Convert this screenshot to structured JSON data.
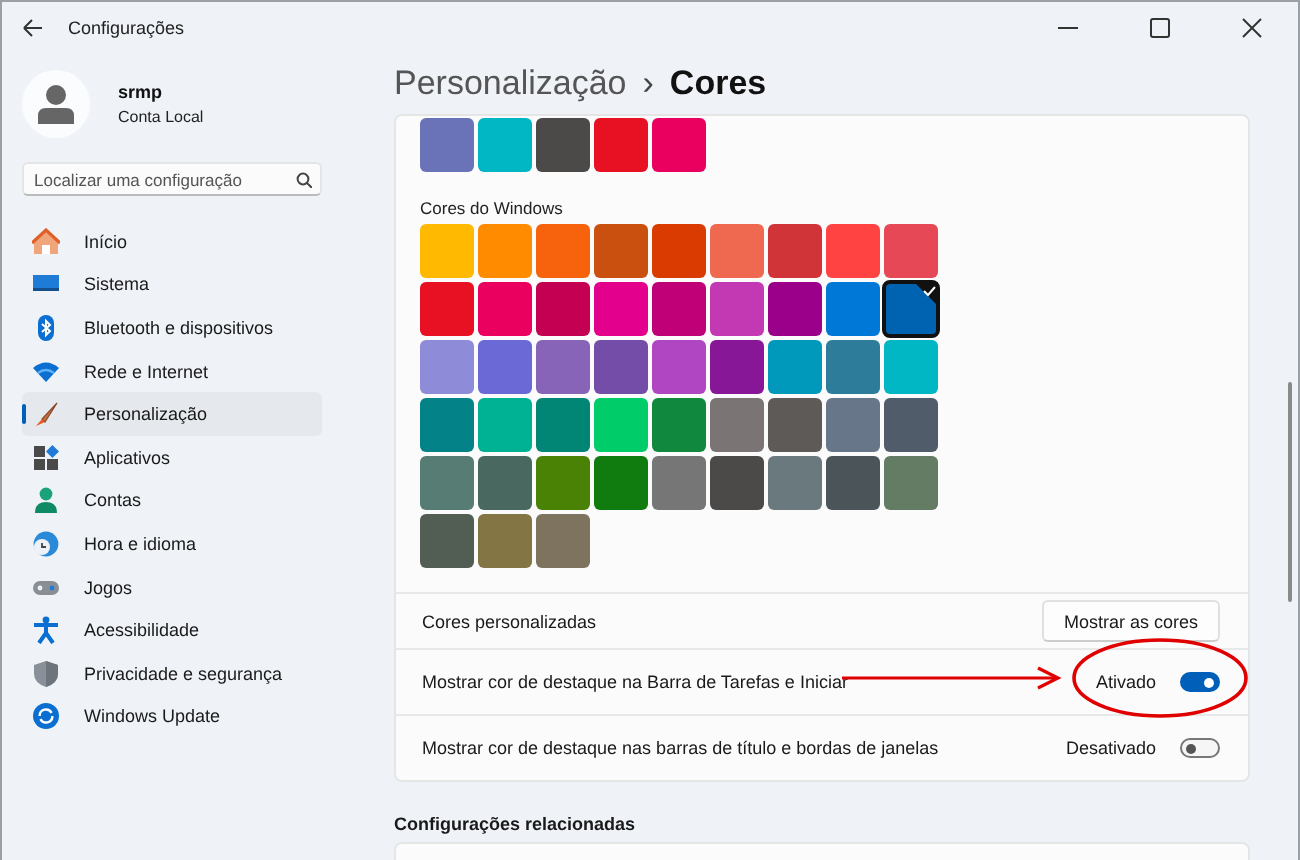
{
  "window": {
    "title": "Configurações"
  },
  "user": {
    "name": "srmp",
    "account": "Conta Local"
  },
  "search": {
    "placeholder": "Localizar uma configuração"
  },
  "sidebar": {
    "items": [
      {
        "label": "Início",
        "selected": false
      },
      {
        "label": "Sistema",
        "selected": false
      },
      {
        "label": "Bluetooth e dispositivos",
        "selected": false
      },
      {
        "label": "Rede e Internet",
        "selected": false
      },
      {
        "label": "Personalização",
        "selected": true
      },
      {
        "label": "Aplicativos",
        "selected": false
      },
      {
        "label": "Contas",
        "selected": false
      },
      {
        "label": "Hora e idioma",
        "selected": false
      },
      {
        "label": "Jogos",
        "selected": false
      },
      {
        "label": "Acessibilidade",
        "selected": false
      },
      {
        "label": "Privacidade e segurança",
        "selected": false
      },
      {
        "label": "Windows Update",
        "selected": false
      }
    ]
  },
  "breadcrumb": {
    "parent": "Personalização",
    "separator": "›",
    "current": "Cores"
  },
  "recent_colors": [
    {
      "color": "#6b73b8"
    },
    {
      "color": "#00b7c3"
    },
    {
      "color": "#4c4a48"
    },
    {
      "color": "#e81123"
    },
    {
      "color": "#ea005e"
    }
  ],
  "windows_colors": {
    "title": "Cores do Windows",
    "swatches": [
      {
        "color": "#ffb900",
        "selected": false
      },
      {
        "color": "#ff8c00",
        "selected": false
      },
      {
        "color": "#f7630c",
        "selected": false
      },
      {
        "color": "#ca5010",
        "selected": false
      },
      {
        "color": "#da3b01",
        "selected": false
      },
      {
        "color": "#ef6950",
        "selected": false
      },
      {
        "color": "#d13438",
        "selected": false
      },
      {
        "color": "#ff4343",
        "selected": false
      },
      {
        "color": "#e74856",
        "selected": false
      },
      {
        "color": "#e81123",
        "selected": false
      },
      {
        "color": "#ea005e",
        "selected": false
      },
      {
        "color": "#c30052",
        "selected": false
      },
      {
        "color": "#e3008c",
        "selected": false
      },
      {
        "color": "#bf0077",
        "selected": false
      },
      {
        "color": "#c239b3",
        "selected": false
      },
      {
        "color": "#9a0089",
        "selected": false
      },
      {
        "color": "#0078d7",
        "selected": false
      },
      {
        "color": "#0063b1",
        "selected": true
      },
      {
        "color": "#8e8cd8",
        "selected": false
      },
      {
        "color": "#6b69d6",
        "selected": false
      },
      {
        "color": "#8764b8",
        "selected": false
      },
      {
        "color": "#744da9",
        "selected": false
      },
      {
        "color": "#b146c2",
        "selected": false
      },
      {
        "color": "#881798",
        "selected": false
      },
      {
        "color": "#0099bc",
        "selected": false
      },
      {
        "color": "#2d7d9a",
        "selected": false
      },
      {
        "color": "#00b7c3",
        "selected": false
      },
      {
        "color": "#038387",
        "selected": false
      },
      {
        "color": "#00b294",
        "selected": false
      },
      {
        "color": "#018574",
        "selected": false
      },
      {
        "color": "#00cc6a",
        "selected": false
      },
      {
        "color": "#10893e",
        "selected": false
      },
      {
        "color": "#7a7574",
        "selected": false
      },
      {
        "color": "#5d5a58",
        "selected": false
      },
      {
        "color": "#68768a",
        "selected": false
      },
      {
        "color": "#515c6b",
        "selected": false
      },
      {
        "color": "#567c73",
        "selected": false
      },
      {
        "color": "#486860",
        "selected": false
      },
      {
        "color": "#498205",
        "selected": false
      },
      {
        "color": "#107c10",
        "selected": false
      },
      {
        "color": "#767676",
        "selected": false
      },
      {
        "color": "#4c4a48",
        "selected": false
      },
      {
        "color": "#69797e",
        "selected": false
      },
      {
        "color": "#4a5459",
        "selected": false
      },
      {
        "color": "#647c64",
        "selected": false
      },
      {
        "color": "#525e54",
        "selected": false
      },
      {
        "color": "#847545",
        "selected": false
      },
      {
        "color": "#7e735f",
        "selected": false
      }
    ]
  },
  "custom_colors": {
    "label": "Cores personalizadas",
    "button": "Mostrar as cores"
  },
  "toggles": [
    {
      "label": "Mostrar cor de destaque na Barra de Tarefas e Iniciar",
      "state": "Ativado",
      "on": true
    },
    {
      "label": "Mostrar cor de destaque nas barras de título e bordas de janelas",
      "state": "Desativado",
      "on": false
    }
  ],
  "related": {
    "title": "Configurações relacionadas"
  }
}
